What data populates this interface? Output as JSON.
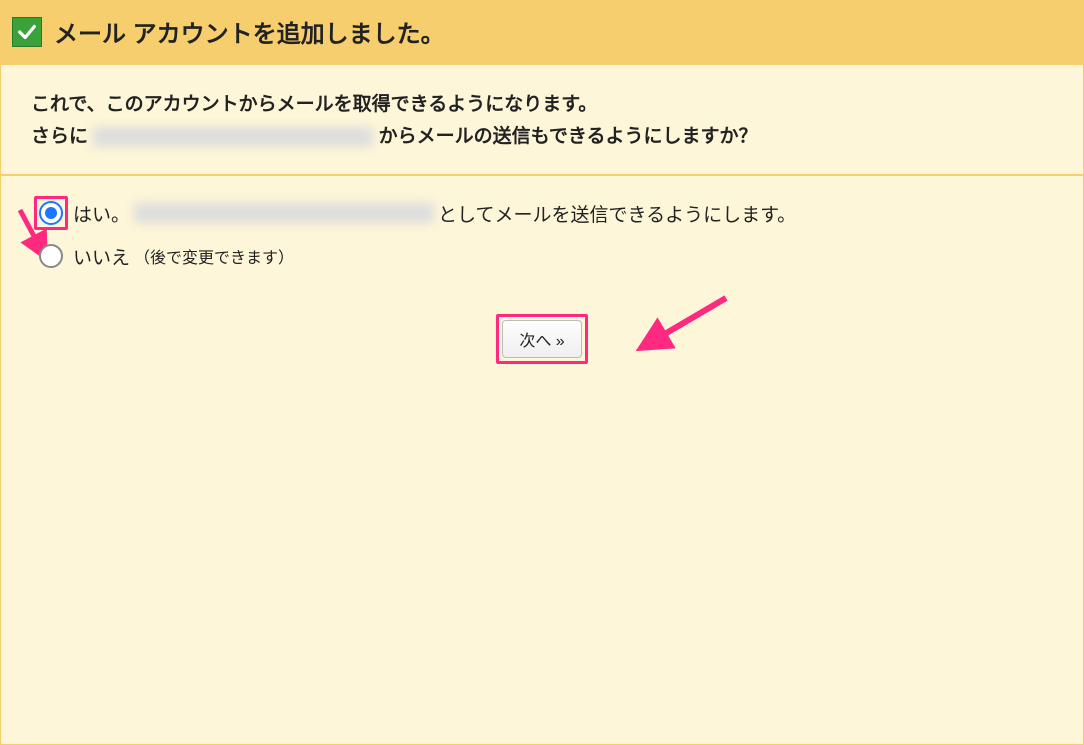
{
  "header": {
    "title": "メール アカウントを追加しました。"
  },
  "intro": {
    "line1": "これで、このアカウントからメールを取得できるようになります。",
    "line2_prefix": "さらに",
    "line2_email_redacted": "████████████████████",
    "line2_suffix": "からメールの送信もできるようにしますか？"
  },
  "options": {
    "yes_prefix": "はい。",
    "yes_email_redacted": "██████████████████████",
    "yes_suffix": "としてメールを送信できるようにします。",
    "no_label": "いいえ",
    "no_note": "（後で変更できます）",
    "selected": "yes"
  },
  "buttons": {
    "next": "次へ »"
  },
  "annotations": {
    "highlight_color": "#ff2a7f"
  }
}
